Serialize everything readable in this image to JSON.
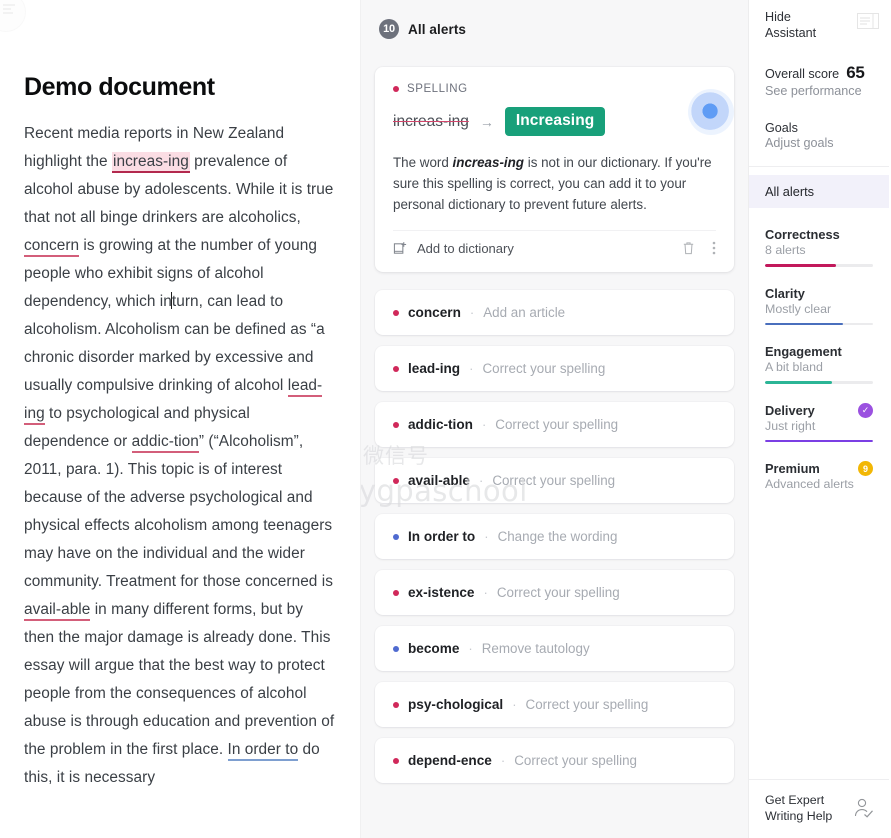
{
  "document": {
    "title": "Demo document",
    "paragraph_parts": [
      {
        "t": "Recent media reports in New Zealand highlight the ",
        "s": "plain"
      },
      {
        "t": "increas-ing",
        "s": "spell-strong"
      },
      {
        "t": " prevalence of alcohol abuse by adolescents. While it is true that not all binge drinkers are alcoholics, ",
        "s": "plain"
      },
      {
        "t": "concern",
        "s": "spell"
      },
      {
        "t": " is growing at the number of young people who exhibit signs of alcohol dependency, which in",
        "s": "plain"
      },
      {
        "t": "caret",
        "s": "caret"
      },
      {
        "t": "turn, can lead to alcoholism. Alcoholism can be defined as “a chronic disorder marked by excessive and usually compulsive drinking of alcohol ",
        "s": "plain"
      },
      {
        "t": "lead-ing",
        "s": "spell"
      },
      {
        "t": " to psychological and physical dependence or ",
        "s": "plain"
      },
      {
        "t": "addic-tion",
        "s": "spell"
      },
      {
        "t": "” (“Alcoholism”, 2011, para. 1). This topic is of interest because of the adverse psychological and physical effects alcoholism among teenagers may have on the individual and the wider community. Treatment for those concerned is ",
        "s": "plain"
      },
      {
        "t": "avail-able",
        "s": "spell"
      },
      {
        "t": " in many different forms, but by then the major damage is already done. This essay will argue that the best way to protect people from the consequences of alcohol abuse is through education and prevention of the problem in the first place. ",
        "s": "plain"
      },
      {
        "t": "In order to",
        "s": "clarity"
      },
      {
        "t": " do this, it is necessary",
        "s": "plain"
      }
    ]
  },
  "watermark": {
    "line1": "微信号",
    "line2": "easygpaschool"
  },
  "alerts_header": {
    "count": "10",
    "title": "All alerts"
  },
  "expanded_card": {
    "category": "SPELLING",
    "category_dot": "spelling",
    "wrong": "increas-ing",
    "arrow": "→",
    "suggestion": "Increasing",
    "explanation_pre": "The word ",
    "explanation_word": "increas-ing",
    "explanation_post": " is not in our dictionary. If you're sure this spelling is correct, you can add it to your personal dictionary to prevent future alerts.",
    "add_label": "Add to dictionary",
    "add_icon": "add-to-dictionary-icon",
    "trash_icon": "trash-icon",
    "more_icon": "more-vertical-icon"
  },
  "alert_rows": [
    {
      "word": "concern",
      "sep": "·",
      "hint": "Add an article",
      "dot": "spelling"
    },
    {
      "word": "lead-ing",
      "sep": "·",
      "hint": "Correct your spelling",
      "dot": "spelling"
    },
    {
      "word": "addic-tion",
      "sep": "·",
      "hint": "Correct your spelling",
      "dot": "spelling"
    },
    {
      "word": "avail-able",
      "sep": "·",
      "hint": "Correct your spelling",
      "dot": "spelling"
    },
    {
      "word": "In order to",
      "sep": "·",
      "hint": "Change the wording",
      "dot": "clarity"
    },
    {
      "word": "ex-istence",
      "sep": "·",
      "hint": "Correct your spelling",
      "dot": "spelling"
    },
    {
      "word": "become",
      "sep": "·",
      "hint": "Remove tautology",
      "dot": "clarity"
    },
    {
      "word": "psy-chological",
      "sep": "·",
      "hint": "Correct your spelling",
      "dot": "spelling"
    },
    {
      "word": "depend-ence",
      "sep": "·",
      "hint": "Correct your spelling",
      "dot": "spelling"
    }
  ],
  "sidebar": {
    "hide_line1": "Hide",
    "hide_line2": "Assistant",
    "hide_icon": "collapse-panel-icon",
    "score_label": "Overall score",
    "score_value": "65",
    "score_link": "See performance",
    "goals_title": "Goals",
    "goals_link": "Adjust goals",
    "all_alerts": "All alerts",
    "metrics": [
      {
        "name": "Correctness",
        "sub": "8 alerts",
        "pct": 66,
        "color": "#c2185b",
        "badge": ""
      },
      {
        "name": "Clarity",
        "sub": "Mostly clear",
        "pct": 72,
        "color": "#4a6fbd",
        "badge": ""
      },
      {
        "name": "Engagement",
        "sub": "A bit bland",
        "pct": 62,
        "color": "#2bb596",
        "badge": ""
      },
      {
        "name": "Delivery",
        "sub": "Just right",
        "pct": 100,
        "color": "#7b3fe4",
        "badge": "check"
      },
      {
        "name": "Premium",
        "sub": "Advanced alerts",
        "pct": 0,
        "color": "#f2b705",
        "badge": "premium",
        "badge_text": "9"
      }
    ],
    "footer_line1": "Get Expert",
    "footer_line2": "Writing Help",
    "footer_icon": "expert-writer-icon"
  }
}
